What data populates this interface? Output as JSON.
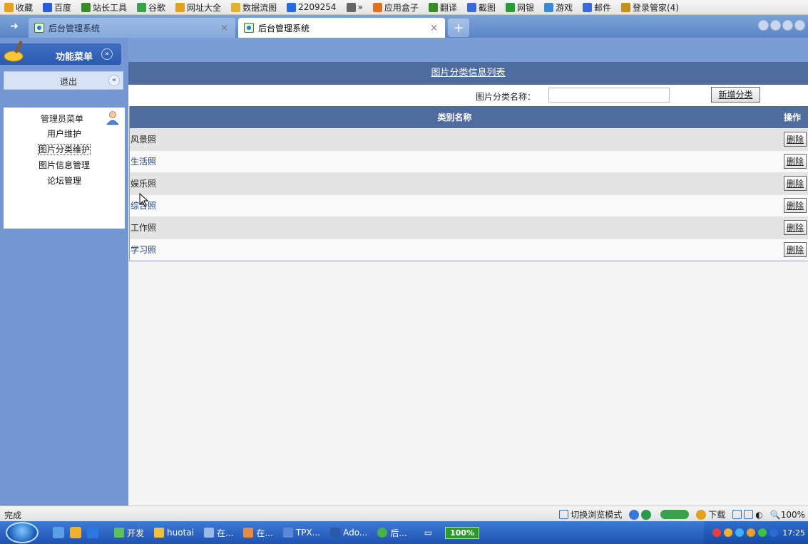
{
  "favorites_bar": {
    "items": [
      {
        "label": "收藏",
        "icon": "star-icon",
        "color": "#e8a020"
      },
      {
        "label": "百度",
        "icon": "baidu-icon",
        "color": "#2a5ed8"
      },
      {
        "label": "站长工具",
        "icon": "tools-icon",
        "color": "#3a8a2a"
      },
      {
        "label": "谷歌",
        "icon": "google-icon",
        "color": "#3aa14a"
      },
      {
        "label": "网址大全",
        "icon": "globe-icon",
        "color": "#e0a020"
      },
      {
        "label": "数据流图",
        "icon": "folder-icon",
        "color": "#e0b030"
      },
      {
        "label": "2209254",
        "icon": "qq-icon",
        "color": "#2a6ad8"
      },
      {
        "label": "»",
        "icon": "more-icon",
        "color": "#666666"
      },
      {
        "label": "应用盒子",
        "icon": "box-icon",
        "color": "#e07020"
      },
      {
        "label": "翻译",
        "icon": "translate-icon",
        "color": "#3a8a2a"
      },
      {
        "label": "截图",
        "icon": "scissors-icon",
        "color": "#3a6ad8"
      },
      {
        "label": "网银",
        "icon": "bank-icon",
        "color": "#2a9a3a"
      },
      {
        "label": "游戏",
        "icon": "game-icon",
        "color": "#3a8ad8"
      },
      {
        "label": "邮件",
        "icon": "mail-icon",
        "color": "#3a6ad8"
      },
      {
        "label": "登录管家(4)",
        "icon": "key-icon",
        "color": "#c09020"
      }
    ]
  },
  "tabs": {
    "items": [
      {
        "label": "后台管理系统",
        "active": false
      },
      {
        "label": "后台管理系统",
        "active": true
      }
    ],
    "close_glyph": "×",
    "new_tab_glyph": "+"
  },
  "sidebar": {
    "header_title": "功能菜单",
    "logout_label": "退出",
    "collapse_glyph": "«",
    "expand_glyph": "»",
    "admin_menu_title": "管理员菜单",
    "items": [
      {
        "label": "用户维护"
      },
      {
        "label": "图片分类维护"
      },
      {
        "label": "图片信息管理"
      },
      {
        "label": "论坛管理"
      }
    ]
  },
  "main": {
    "list_title": "图片分类信息列表",
    "search_label": "图片分类名称：",
    "search_value": "",
    "add_button_label": "新增分类",
    "table": {
      "headers": [
        "类别名称",
        "操作"
      ],
      "rows": [
        {
          "name": "风景照",
          "action": "删除"
        },
        {
          "name": "生活照",
          "action": "删除"
        },
        {
          "name": "娱乐照",
          "action": "删除"
        },
        {
          "name": "综合照",
          "action": "删除"
        },
        {
          "name": "工作照",
          "action": "删除"
        },
        {
          "name": "学习照",
          "action": "删除"
        }
      ]
    }
  },
  "status_bar": {
    "status_text": "完成",
    "switch_mode_label": "切换浏览模式",
    "download_label": "下载",
    "zoom_label": "100%"
  },
  "taskbar": {
    "items": [
      {
        "label": "开发"
      },
      {
        "label": "huotai"
      },
      {
        "label": "在..."
      },
      {
        "label": "在..."
      },
      {
        "label": "TPX..."
      },
      {
        "label": "Ado..."
      },
      {
        "label": "后..."
      }
    ],
    "zoom_badge": "100%",
    "clock": "17:25"
  }
}
